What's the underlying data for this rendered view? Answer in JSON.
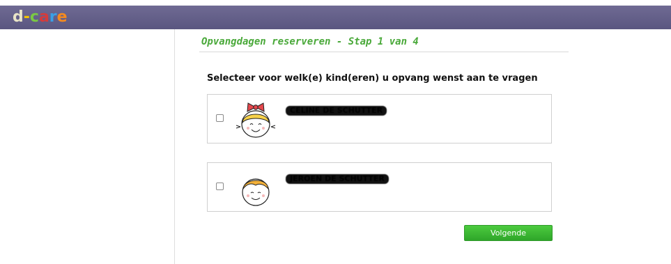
{
  "app": {
    "logo_text": "d-care",
    "logo_colors": [
      "#f2c200",
      "#f2c200",
      "#7ac943",
      "#d53b3b",
      "#3aa0e6",
      "#f58a1f"
    ]
  },
  "page": {
    "title": "Opvangdagen reserveren - Stap 1 van 4",
    "instruction": "Selecteer voor welk(e) kind(eren) u opvang wenst aan te vragen",
    "accent_color": "#4aa93a"
  },
  "children": [
    {
      "name": "CELINE DE SCHUTTER",
      "avatar": "girl-with-bow-icon",
      "checked": false
    },
    {
      "name": "JEROEN DE SCHUTTER",
      "avatar": "boy-face-icon",
      "checked": false
    }
  ],
  "actions": {
    "next_label": "Volgende"
  }
}
